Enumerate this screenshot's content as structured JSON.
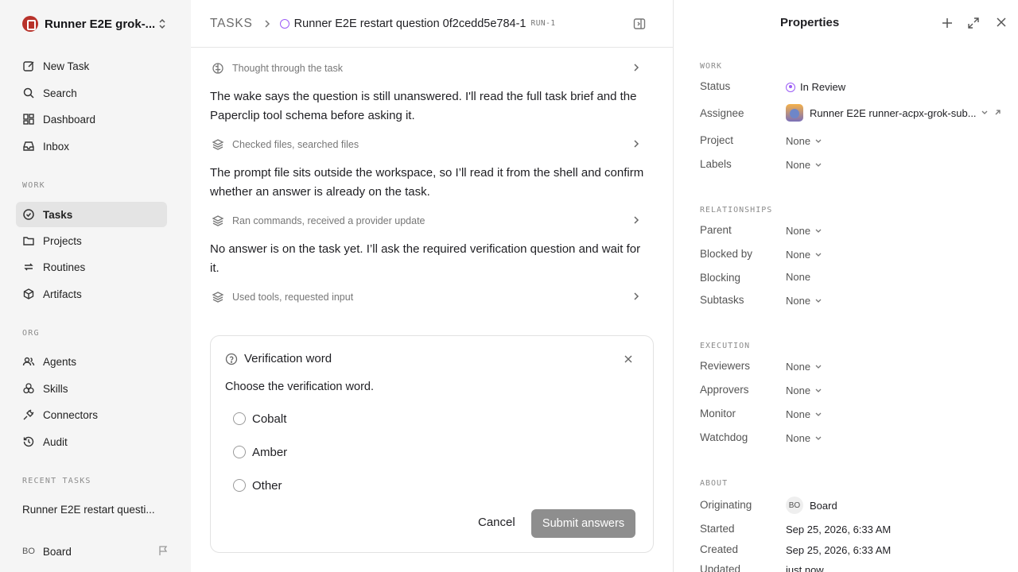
{
  "sidebar": {
    "workspace": "Runner E2E grok-...",
    "nav": [
      {
        "label": "New Task",
        "icon": "edit-icon"
      },
      {
        "label": "Search",
        "icon": "search-icon"
      },
      {
        "label": "Dashboard",
        "icon": "dashboard-icon"
      },
      {
        "label": "Inbox",
        "icon": "inbox-icon"
      }
    ],
    "work_section": "WORK",
    "work": [
      {
        "label": "Tasks",
        "icon": "check-circle-icon",
        "active": true
      },
      {
        "label": "Projects",
        "icon": "folder-icon"
      },
      {
        "label": "Routines",
        "icon": "repeat-icon"
      },
      {
        "label": "Artifacts",
        "icon": "package-icon"
      }
    ],
    "org_section": "ORG",
    "org": [
      {
        "label": "Agents",
        "icon": "users-icon"
      },
      {
        "label": "Skills",
        "icon": "skills-icon"
      },
      {
        "label": "Connectors",
        "icon": "plug-icon"
      },
      {
        "label": "Audit",
        "icon": "history-icon"
      }
    ],
    "recent_section": "RECENT TASKS",
    "recent_item": "Runner E2E restart questi...",
    "user_initials": "BO",
    "user_name": "Board"
  },
  "header": {
    "crumb": "TASKS",
    "title": "Runner E2E restart question 0f2cedd5e784-1",
    "run": "RUN-1"
  },
  "thread": {
    "steps": [
      "Thought through the task",
      "Checked files, searched files",
      "Ran commands, received a provider update",
      "Used tools, requested input"
    ],
    "messages": [
      "The wake says the question is still unanswered. I'll read the full task brief and the Paperclip tool schema before asking it.",
      "The prompt file sits outside the workspace, so I’ll read it from the shell and confirm whether an answer is already on the task.",
      "No answer is on the task yet. I’ll ask the required verification question and wait for it."
    ]
  },
  "question": {
    "title": "Verification word",
    "prompt": "Choose the verification word.",
    "options": [
      "Cobalt",
      "Amber",
      "Other"
    ],
    "cancel": "Cancel",
    "submit": "Submit answers"
  },
  "properties": {
    "title": "Properties",
    "work_section": "WORK",
    "status_label": "Status",
    "status_value": "In Review",
    "assignee_label": "Assignee",
    "assignee_value": "Runner E2E runner-acpx-grok-sub...",
    "project_label": "Project",
    "project_value": "None",
    "labels_label": "Labels",
    "labels_value": "None",
    "rel_section": "RELATIONSHIPS",
    "parent_label": "Parent",
    "parent_value": "None",
    "blockedby_label": "Blocked by",
    "blockedby_value": "None",
    "blocking_label": "Blocking",
    "blocking_value": "None",
    "subtasks_label": "Subtasks",
    "subtasks_value": "None",
    "exec_section": "EXECUTION",
    "reviewers_label": "Reviewers",
    "reviewers_value": "None",
    "approvers_label": "Approvers",
    "approvers_value": "None",
    "monitor_label": "Monitor",
    "monitor_value": "None",
    "watchdog_label": "Watchdog",
    "watchdog_value": "None",
    "about_section": "ABOUT",
    "originating_label": "Originating",
    "originating_initials": "BO",
    "originating_value": "Board",
    "started_label": "Started",
    "started_value": "Sep 25, 2026, 6:33 AM",
    "created_label": "Created",
    "created_value": "Sep 25, 2026, 6:33 AM",
    "updated_label": "Updated",
    "updated_value": "just now"
  },
  "colors": {
    "sidebar_bg": "#f5f5f5",
    "active_item_bg": "#e4e4e4",
    "status_purple": "#9b5cf6",
    "submit_disabled": "#8e8e8e",
    "logo_red": "#b8322a"
  }
}
